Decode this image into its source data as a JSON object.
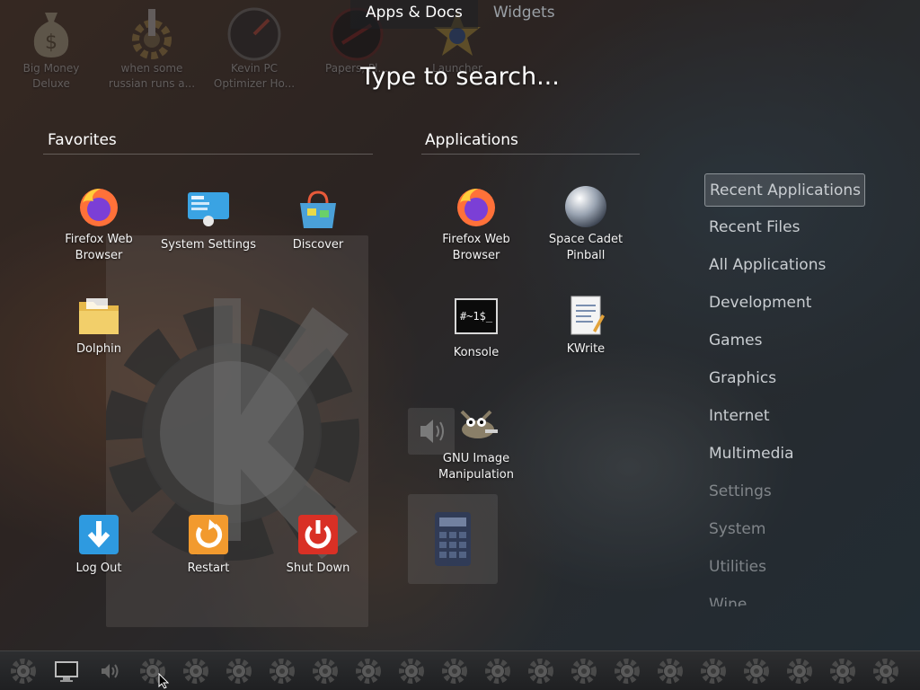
{
  "tabs": [
    {
      "label": "Apps & Docs",
      "active": true
    },
    {
      "label": "Widgets",
      "active": false
    }
  ],
  "search": {
    "placeholder": "Type to search..."
  },
  "desktop_icons": [
    {
      "line1": "Big Money",
      "line2": "Deluxe",
      "icon": "money-bag-icon"
    },
    {
      "line1": "when some",
      "line2": "russian runs a...",
      "icon": "gear-icon"
    },
    {
      "line1": "Kevin PC",
      "line2": "Optimizer Ho...",
      "icon": "gauge-icon"
    },
    {
      "line1": "Papers, Pl...",
      "line2": "",
      "icon": "record-icon"
    },
    {
      "line1": "",
      "line2": "Launcher",
      "icon": "star-icon"
    }
  ],
  "favorites": {
    "title": "Favorites",
    "items": [
      {
        "label": "Firefox Web Browser",
        "icon": "firefox-icon"
      },
      {
        "label": "System Settings",
        "icon": "system-settings-icon"
      },
      {
        "label": "Discover",
        "icon": "discover-icon"
      },
      {
        "label": "Dolphin",
        "icon": "folder-icon"
      }
    ],
    "session": [
      {
        "label": "Log Out",
        "icon": "logout-icon"
      },
      {
        "label": "Restart",
        "icon": "restart-icon"
      },
      {
        "label": "Shut Down",
        "icon": "shutdown-icon"
      }
    ]
  },
  "applications": {
    "title": "Applications",
    "items": [
      {
        "label": "Firefox Web Browser",
        "icon": "firefox-icon"
      },
      {
        "label": "Space Cadet Pinball",
        "icon": "pinball-icon"
      },
      {
        "label": "Konsole",
        "icon": "terminal-icon"
      },
      {
        "label": "KWrite",
        "icon": "kwrite-icon"
      },
      {
        "label": "GNU Image Manipulation",
        "icon": "gimp-icon"
      }
    ],
    "konsole_text": "#~1$_"
  },
  "categories": [
    {
      "label": "Recent Applications",
      "selected": true
    },
    {
      "label": "Recent Files"
    },
    {
      "label": "All Applications"
    },
    {
      "label": "Development"
    },
    {
      "label": "Games"
    },
    {
      "label": "Graphics"
    },
    {
      "label": "Internet"
    },
    {
      "label": "Multimedia"
    },
    {
      "label": "Settings"
    },
    {
      "label": "System"
    },
    {
      "label": "Utilities"
    },
    {
      "label": "Wine"
    }
  ],
  "taskbar": {
    "items": [
      "kde-gear-icon",
      "monitor-icon",
      "volume-icon",
      "kde-gear-icon",
      "kde-gear-icon",
      "kde-gear-icon",
      "kde-gear-icon",
      "kde-gear-icon",
      "kde-gear-icon",
      "kde-gear-icon",
      "kde-gear-icon",
      "kde-gear-icon",
      "kde-gear-icon",
      "kde-gear-icon",
      "kde-gear-icon",
      "kde-gear-icon",
      "kde-gear-icon",
      "kde-gear-icon",
      "kde-gear-icon",
      "kde-gear-icon",
      "kde-gear-icon"
    ]
  },
  "colors": {
    "accent": "#ffffff",
    "muted": "#9aa0a6",
    "firefox": "#ff7139",
    "shutdown": "#d93025"
  }
}
